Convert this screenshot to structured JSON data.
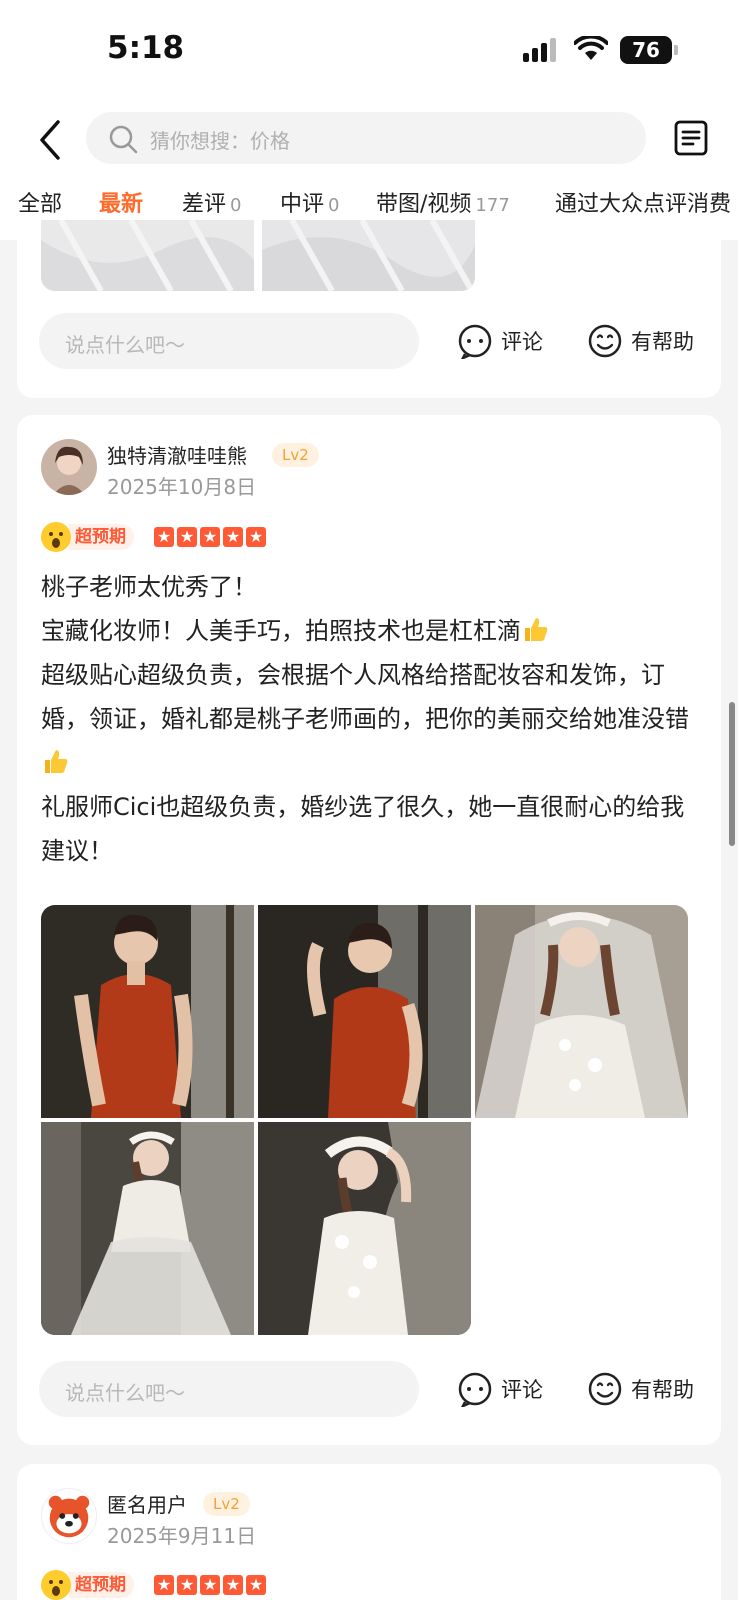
{
  "status_bar": {
    "time": "5:18",
    "battery": "76"
  },
  "search": {
    "placeholder": "猜你想搜：价格"
  },
  "tabs": [
    {
      "label": "全部",
      "count": ""
    },
    {
      "label": "最新",
      "count": ""
    },
    {
      "label": "差评",
      "count": "0"
    },
    {
      "label": "中评",
      "count": "0"
    },
    {
      "label": "带图/视频",
      "count": "177"
    },
    {
      "label": "通过大众点评消费",
      "count": ""
    }
  ],
  "active_tab_index": 1,
  "actions": {
    "comment_placeholder": "说点什么吧～",
    "comment_label": "评论",
    "helpful_label": "有帮助"
  },
  "reviews": [
    {
      "username": "独特清澈哇哇熊",
      "level": "Lv2",
      "date": "2025年10月8日",
      "badge": "超预期",
      "stars": 5,
      "lines": [
        "桃子老师太优秀了！",
        "宝藏化妆师！人美手巧，拍照技术也是杠杠滴",
        "超级贴心超级负责，会根据个人风格给搭配妆容和发饰，订婚，领证，婚礼都是桃子老师画的，把你的美丽交给她准没错",
        "礼服师Cici也超级负责，婚纱选了很久，她一直很耐心的给我建议！"
      ]
    },
    {
      "username": "匿名用户",
      "level": "Lv2",
      "date": "2025年9月11日",
      "badge": "超预期",
      "stars": 5
    }
  ],
  "colors": {
    "accent": "#ff6b2c",
    "badge_red": "#ff5a36",
    "level_orange": "#f5a033"
  }
}
